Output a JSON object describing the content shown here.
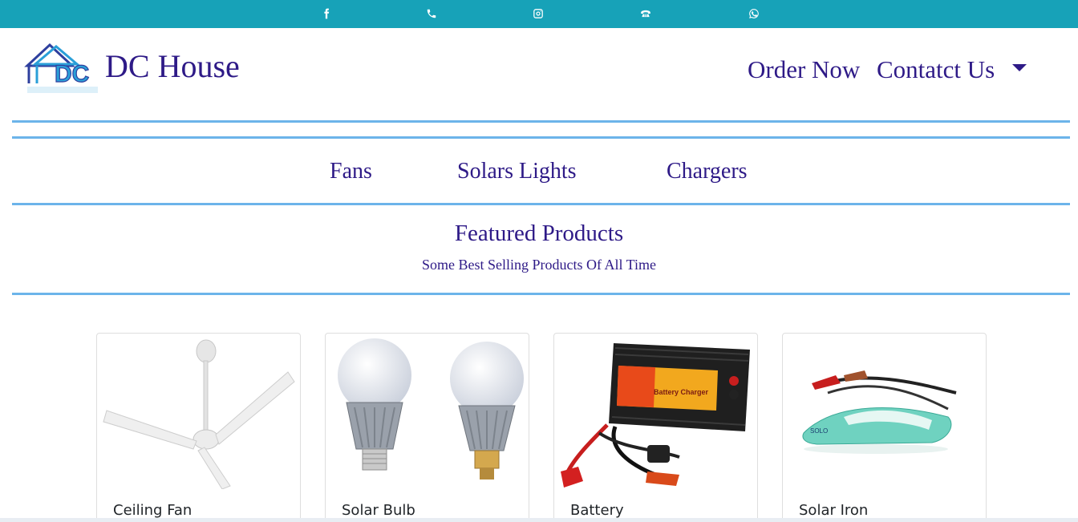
{
  "topbar": {
    "icons": [
      "facebook-icon",
      "phone-icon",
      "instagram-icon",
      "telephone-icon",
      "whatsapp-icon"
    ]
  },
  "header": {
    "brand": "DC House",
    "nav": {
      "order_now": "Order Now",
      "contact_us": "Contatct Us"
    }
  },
  "categories": [
    "Fans",
    "Solars Lights",
    "Chargers"
  ],
  "featured": {
    "title": "Featured Products",
    "subtitle": "Some Best Selling Products Of All Time"
  },
  "products": [
    {
      "name": "Ceiling Fan"
    },
    {
      "name": "Solar Bulb"
    },
    {
      "name": "Battery"
    },
    {
      "name": "Solar Iron"
    }
  ],
  "colors": {
    "topbar": "#17a2b8",
    "brand_text": "#2e1a87",
    "divider": "#6cb4ea"
  }
}
